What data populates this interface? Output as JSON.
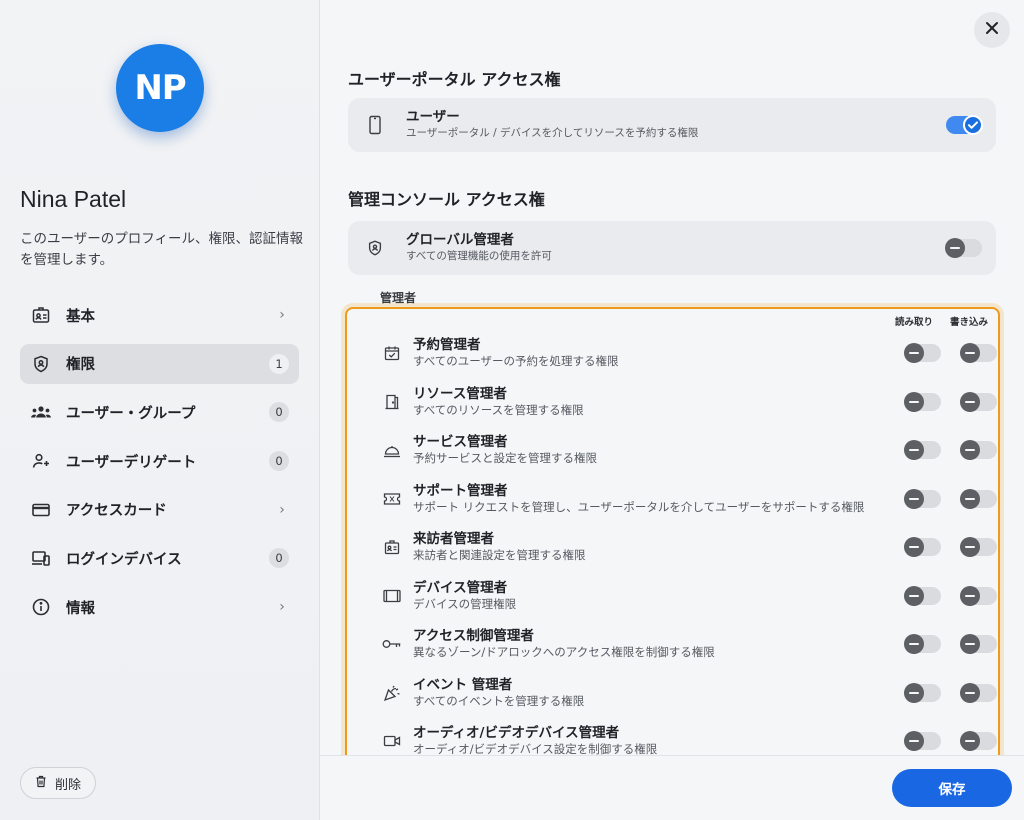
{
  "profile": {
    "initials": "NP",
    "name": "Nina Patel",
    "description": "このユーザーのプロフィール、権限、認証情報を管理します。",
    "avatar_color": "#1a7ee6"
  },
  "nav": {
    "items": [
      {
        "label": "基本",
        "icon": "id-card-icon",
        "trailing": "chevron"
      },
      {
        "label": "権限",
        "icon": "shield-icon",
        "trailing": "badge",
        "badge": "1",
        "active": true
      },
      {
        "label": "ユーザー・グループ",
        "icon": "group-icon",
        "trailing": "badge",
        "badge": "0"
      },
      {
        "label": "ユーザーデリゲート",
        "icon": "delegate-icon",
        "trailing": "badge",
        "badge": "0"
      },
      {
        "label": "アクセスカード",
        "icon": "credit-card-icon",
        "trailing": "chevron"
      },
      {
        "label": "ログインデバイス",
        "icon": "devices-icon",
        "trailing": "badge",
        "badge": "0"
      },
      {
        "label": "情報",
        "icon": "info-icon",
        "trailing": "chevron"
      }
    ]
  },
  "delete_label": "削除",
  "portal": {
    "section_title": "ユーザーポータル アクセス権",
    "title": "ユーザー",
    "subtitle": "ユーザーポータル / デバイスを介してリソースを予約する権限",
    "enabled": true
  },
  "console": {
    "section_title": "管理コンソール アクセス権",
    "title": "グローバル管理者",
    "subtitle": "すべての管理機能の使用を許可",
    "enabled": false
  },
  "admins": {
    "label": "管理者",
    "col_read": "読み取り",
    "col_write": "書き込み",
    "rows": [
      {
        "title": "予約管理者",
        "subtitle": "すべてのユーザーの予約を処理する権限",
        "icon": "calendar-check-icon"
      },
      {
        "title": "リソース管理者",
        "subtitle": "すべてのリソースを管理する権限",
        "icon": "door-icon"
      },
      {
        "title": "サービス管理者",
        "subtitle": "予約サービスと設定を管理する権限",
        "icon": "service-bell-icon"
      },
      {
        "title": "サポート管理者",
        "subtitle": "サポート リクエストを管理し、ユーザーポータルを介してユーザーをサポートする権限",
        "icon": "ticket-icon"
      },
      {
        "title": "来訪者管理者",
        "subtitle": "来訪者と関連設定を管理する権限",
        "icon": "visitor-badge-icon"
      },
      {
        "title": "デバイス管理者",
        "subtitle": "デバイスの管理権限",
        "icon": "tablet-icon"
      },
      {
        "title": "アクセス制御管理者",
        "subtitle": "異なるゾーン/ドアロックへのアクセス権限を制御する権限",
        "icon": "key-icon"
      },
      {
        "title": "イベント 管理者",
        "subtitle": "すべてのイベントを管理する権限",
        "icon": "party-popper-icon"
      },
      {
        "title": "オーディオ/ビデオデバイス管理者",
        "subtitle": "オーディオ/ビデオデバイス設定を制御する権限",
        "icon": "video-camera-icon"
      }
    ]
  },
  "save_label": "保存"
}
